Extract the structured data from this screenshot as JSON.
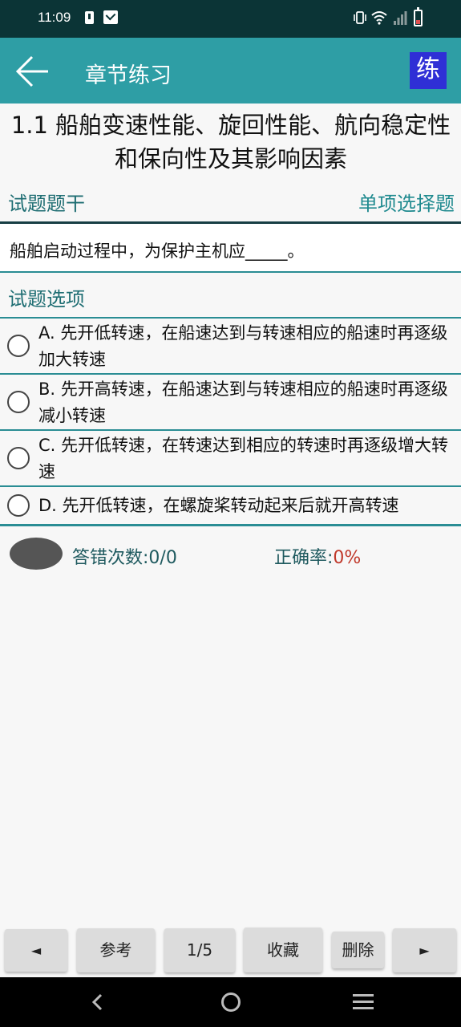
{
  "status_bar": {
    "time": "11:09",
    "left_icons": [
      "alert-icon",
      "mail-icon"
    ],
    "right_icons": [
      "vibrate-icon",
      "wifi-icon",
      "signal-icon",
      "battery-icon"
    ],
    "battery_level_color": "#e05050"
  },
  "app_bar": {
    "title": "章节练习",
    "badge": "练",
    "background": "#2e9ea5",
    "badge_color": "#2f2fd6"
  },
  "question": {
    "chapter_title": "1.1 船舶变速性能、旋回性能、航向稳定性和保向性及其影响因素",
    "stem_label": "试题题干",
    "type": "单项选择题",
    "stem": "船舶启动过程中，为保护主机应_____。",
    "options_label": "试题选项",
    "options": [
      {
        "text": "A. 先开低转速，在船速达到与转速相应的船速时再逐级加大转速",
        "selected": false
      },
      {
        "text": "B. 先开高转速，在船速达到与转速相应的船速时再逐级减小转速",
        "selected": false
      },
      {
        "text": "C. 先开低转速，在转速达到相应的转速时再逐级增大转速",
        "selected": false
      },
      {
        "text": "D. 先开低转速，在螺旋桨转动起来后就开高转速",
        "selected": false
      }
    ]
  },
  "stats": {
    "wrong_label": "答错次数:",
    "wrong_value": "0/0",
    "accuracy_label": "正确率:",
    "accuracy_value": "0%",
    "accuracy_color": "#c0392b"
  },
  "toolbar": {
    "prev": "◄",
    "reference": "参考",
    "page": "1/5",
    "favorite": "收藏",
    "delete": "删除",
    "next": "►"
  },
  "nav_bar": [
    "back-icon",
    "home-icon",
    "menu-icon"
  ]
}
